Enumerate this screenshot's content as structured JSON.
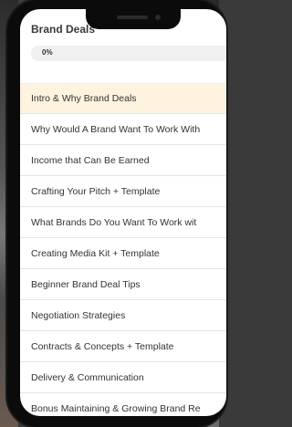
{
  "course": {
    "title": "Brand Deals",
    "progress_label": "0%",
    "progress_value": 0
  },
  "lessons": [
    {
      "label": "Intro & Why Brand Deals",
      "active": true
    },
    {
      "label": "Why Would A Brand Want To Work With",
      "active": false
    },
    {
      "label": "Income that Can Be Earned",
      "active": false
    },
    {
      "label": "Crafting Your Pitch + Template",
      "active": false
    },
    {
      "label": "What Brands Do You Want To Work wit",
      "active": false
    },
    {
      "label": "Creating Media Kit + Template",
      "active": false
    },
    {
      "label": "Beginner Brand Deal Tips",
      "active": false
    },
    {
      "label": "Negotiation Strategies",
      "active": false
    },
    {
      "label": "Contracts & Concepts + Template",
      "active": false
    },
    {
      "label": "Delivery & Communication",
      "active": false
    },
    {
      "label": "Bonus Maintaining & Growing Brand Re",
      "active": false
    }
  ]
}
